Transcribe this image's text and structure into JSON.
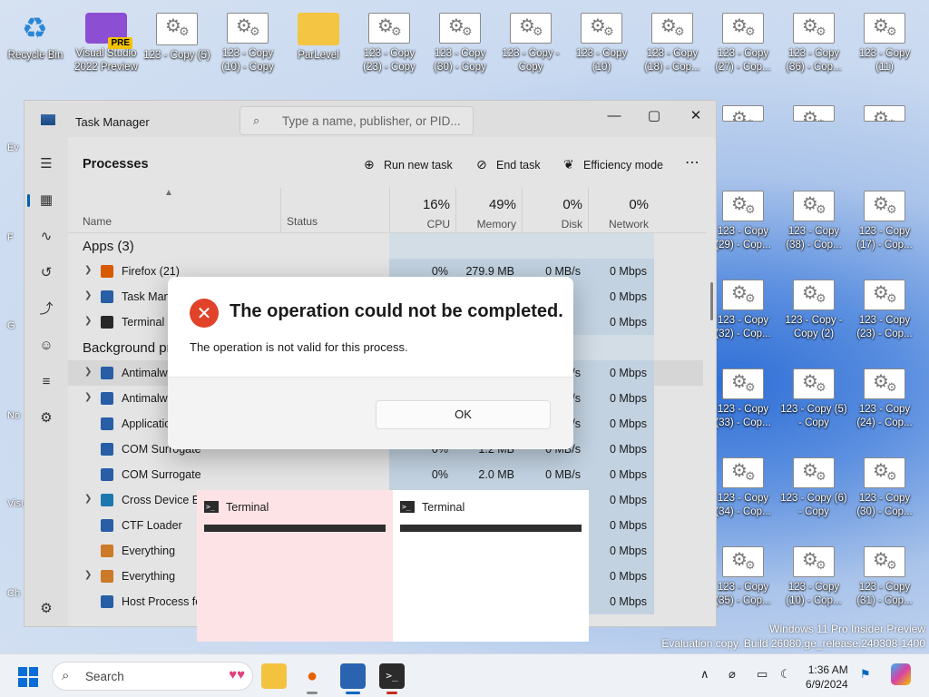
{
  "desktop": {
    "icons_top": [
      {
        "label": "Recycle Bin",
        "kind": "recycle"
      },
      {
        "label": "Visual Studio 2022 Preview",
        "kind": "vs"
      },
      {
        "label": "123 - Copy (5)",
        "kind": "cfg"
      },
      {
        "label": "123 - Copy (10) - Copy",
        "kind": "cfg"
      },
      {
        "label": "ParLevel",
        "kind": "folder"
      },
      {
        "label": "123 - Copy (23) - Copy",
        "kind": "cfg"
      },
      {
        "label": "123 - Copy (30) - Copy",
        "kind": "cfg"
      },
      {
        "label": "123 - Copy - Copy",
        "kind": "cfg"
      },
      {
        "label": "123 - Copy (10)",
        "kind": "cfg"
      },
      {
        "label": "123 - Copy (18) - Cop...",
        "kind": "cfg"
      },
      {
        "label": "123 - Copy (27) - Cop...",
        "kind": "cfg"
      },
      {
        "label": "123 - Copy (36) - Cop...",
        "kind": "cfg"
      },
      {
        "label": "123 - Copy (11)",
        "kind": "cfg"
      }
    ],
    "icons_right": [
      {
        "label": "123 - Copy (29) - Cop...",
        "col": 0,
        "row": 0
      },
      {
        "label": "123 - Copy (38) - Cop...",
        "col": 1,
        "row": 0
      },
      {
        "label": "123 - Copy (17) - Cop...",
        "col": 2,
        "row": 0
      },
      {
        "label": "123 - Copy (32) - Cop...",
        "col": 0,
        "row": 1
      },
      {
        "label": "123 - Copy - Copy (2)",
        "col": 1,
        "row": 1
      },
      {
        "label": "123 - Copy (23) - Cop...",
        "col": 2,
        "row": 1
      },
      {
        "label": "123 - Copy (33) - Cop...",
        "col": 0,
        "row": 2
      },
      {
        "label": "123 - Copy (5) - Copy",
        "col": 1,
        "row": 2
      },
      {
        "label": "123 - Copy (24) - Cop...",
        "col": 2,
        "row": 2
      },
      {
        "label": "123 - Copy (34) - Cop...",
        "col": 0,
        "row": 3
      },
      {
        "label": "123 - Copy (6) - Copy",
        "col": 1,
        "row": 3
      },
      {
        "label": "123 - Copy (30) - Cop...",
        "col": 2,
        "row": 3
      },
      {
        "label": "123 - Copy (35) - Cop...",
        "col": 0,
        "row": 4
      },
      {
        "label": "123 - Copy (10) - Cop...",
        "col": 1,
        "row": 4
      },
      {
        "label": "123 - Copy (31) - Cop...",
        "col": 2,
        "row": 4
      }
    ],
    "left_edge_labels": [
      "Ev",
      "F",
      "G",
      "No",
      "Visu",
      "Ch"
    ],
    "watermark_line1": "Windows 11 Pro Insider Preview",
    "watermark_line2": "Evaluation copy. Build 26080.ge_release.240308-1400"
  },
  "task_manager": {
    "title": "Task Manager",
    "search_placeholder": "Type a name, publisher, or PID...",
    "section_title": "Processes",
    "toolbar": {
      "run_new_task": "Run new task",
      "end_task": "End task",
      "efficiency_mode": "Efficiency mode"
    },
    "columns": {
      "name": "Name",
      "status": "Status",
      "cpu_pct": "16%",
      "cpu": "CPU",
      "memory_pct": "49%",
      "memory": "Memory",
      "disk_pct": "0%",
      "disk": "Disk",
      "network_pct": "0%",
      "network": "Network"
    },
    "rows": [
      {
        "type": "group",
        "name": "Apps (3)"
      },
      {
        "type": "proc",
        "name": "Firefox (21)",
        "expand": true,
        "icon": "#e66000",
        "cpu": "0%",
        "mem": "279.9 MB",
        "disk": "0 MB/s",
        "net": "0 Mbps"
      },
      {
        "type": "proc",
        "name": "Task Manager",
        "expand": true,
        "icon": "#2a64b0",
        "cpu": "",
        "mem": "",
        "disk": "",
        "net": "0 Mbps"
      },
      {
        "type": "proc",
        "name": "Terminal (3)",
        "expand": true,
        "icon": "#2b2b2b",
        "cpu": "",
        "mem": "",
        "disk": "",
        "net": "0 Mbps"
      },
      {
        "type": "group",
        "name": "Background processes"
      },
      {
        "type": "proc",
        "name": "Antimalware Service Executable",
        "expand": true,
        "icon": "#2a64b0",
        "cpu": "",
        "mem": "",
        "disk": "/s",
        "net": "0 Mbps",
        "selected": true
      },
      {
        "type": "proc",
        "name": "Antimalware Core Service",
        "expand": true,
        "icon": "#2a64b0",
        "cpu": "",
        "mem": "",
        "disk": "/s",
        "net": "0 Mbps"
      },
      {
        "type": "proc",
        "name": "Application Frame Host",
        "expand": false,
        "icon": "#2a64b0",
        "cpu": "",
        "mem": "",
        "disk": "/s",
        "net": "0 Mbps"
      },
      {
        "type": "proc",
        "name": "COM Surrogate",
        "expand": false,
        "icon": "#2a64b0",
        "cpu": "0%",
        "mem": "1.2 MB",
        "disk": "0 MB/s",
        "net": "0 Mbps"
      },
      {
        "type": "proc",
        "name": "COM Surrogate",
        "expand": false,
        "icon": "#2a64b0",
        "cpu": "0%",
        "mem": "2.0 MB",
        "disk": "0 MB/s",
        "net": "0 Mbps"
      },
      {
        "type": "proc",
        "name": "Cross Device Experience Host",
        "expand": true,
        "icon": "#1d7fb8",
        "cpu": "",
        "mem": "",
        "disk": "",
        "net": "0 Mbps"
      },
      {
        "type": "proc",
        "name": "CTF Loader",
        "expand": false,
        "icon": "#2a64b0",
        "cpu": "",
        "mem": "",
        "disk": "",
        "net": "0 Mbps"
      },
      {
        "type": "proc",
        "name": "Everything",
        "expand": false,
        "icon": "#d9822b",
        "cpu": "",
        "mem": "",
        "disk": "",
        "net": "0 Mbps"
      },
      {
        "type": "proc",
        "name": "Everything",
        "expand": true,
        "icon": "#d9822b",
        "cpu": "",
        "mem": "",
        "disk": "",
        "net": "0 Mbps"
      },
      {
        "type": "proc",
        "name": "Host Process for Windows Tasks",
        "expand": false,
        "icon": "#2a64b0",
        "cpu": "",
        "mem": "",
        "disk": "",
        "net": "0 Mbps"
      }
    ]
  },
  "dialog": {
    "title": "The operation could not be completed.",
    "message": "The operation is not valid for this process.",
    "ok_label": "OK"
  },
  "thumbnails": [
    {
      "title": "Terminal",
      "bg": "#fde3e6"
    },
    {
      "title": "Terminal",
      "bg": "#ffffff"
    }
  ],
  "taskbar": {
    "search_label": "Search",
    "time": "1:36 AM",
    "date": "6/9/2024"
  }
}
